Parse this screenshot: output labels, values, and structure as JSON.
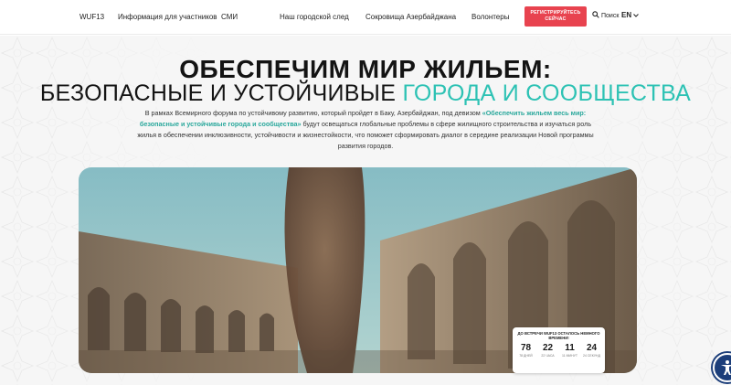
{
  "header": {
    "nav_left": [
      "WUF13",
      "Информация для участников",
      "СМИ"
    ],
    "nav_center": [
      "Наш городской след",
      "Сокровища Азербайджана",
      "Волонтеры"
    ],
    "register_label": "РЕГИСТРИРУЙТЕСЬ СЕЙЧАС",
    "search_label": "Поиск",
    "language": "EN"
  },
  "hero_text": {
    "title_line1": "ОБЕСПЕЧИМ МИР ЖИЛЬЕМ:",
    "title_line2_plain": "БЕЗОПАСНЫЕ И УСТОЙЧИВЫЕ ",
    "title_line2_accent": "ГОРОДА И СООБЩЕСТВА",
    "intro_part1": "В рамках Всемирного форума по устойчивому развитию, который пройдет в Баку, Азербайджан, под девизом ",
    "intro_highlight": "«Обеспечить жильем весь мир: безопасные и устойчивые города и сообщества»",
    "intro_part2": " будут освещаться глобальные проблемы в сфере жилищного строительства и изучаться роль жилья в обеспечении инклюзивности, устойчивости и жизнестойкости, что поможет сформировать диалог в середине реализации Новой программы развития городов."
  },
  "countdown": {
    "title": "ДО ВСТРЕЧИ WUF13 ОСТАЛОСЬ НЕМНОГО ВРЕМЕНИ!",
    "cells": [
      {
        "value": "78",
        "unit": "78 ДНЕЙ"
      },
      {
        "value": "22",
        "unit": "22 ЧАСА"
      },
      {
        "value": "11",
        "unit": "11 МИНУТ"
      },
      {
        "value": "24",
        "unit": "24 СЕКУНД"
      }
    ]
  },
  "icons": {
    "search": "search-icon",
    "language_dropdown": "chevron-down-icon",
    "accessibility": "accessibility-icon"
  },
  "colors": {
    "accent": "#2dc2b4",
    "register": "#e8434f",
    "accessibility": "#1c3e7a"
  }
}
